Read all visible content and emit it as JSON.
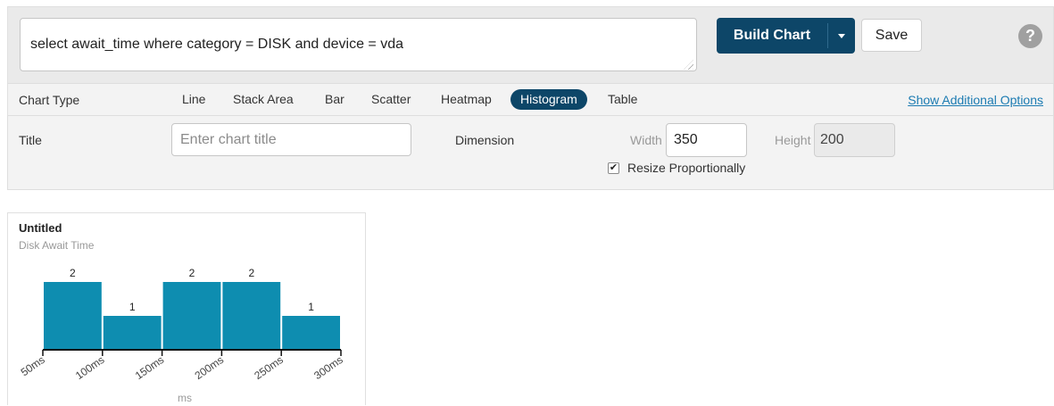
{
  "query": {
    "text": "select await_time where category = DISK and device = vda"
  },
  "toolbar": {
    "build_label": "Build Chart",
    "save_label": "Save",
    "help_label": "?"
  },
  "chart_types": {
    "label": "Chart Type",
    "items": [
      "Line",
      "Stack Area",
      "Bar",
      "Scatter",
      "Heatmap",
      "Histogram",
      "Table"
    ],
    "selected": "Histogram",
    "more_link": "Show Additional Options"
  },
  "options": {
    "title_label": "Title",
    "title_placeholder": "Enter chart title",
    "dimension_label": "Dimension",
    "width_label": "Width",
    "width_value": "350",
    "height_label": "Height",
    "height_value": "200",
    "resize_label": "Resize Proportionally",
    "resize_checked": true
  },
  "chart_card": {
    "title": "Untitled",
    "subtitle": "Disk Await Time"
  },
  "chart_data": {
    "type": "bar",
    "title": "Untitled",
    "subtitle": "Disk Await Time",
    "xlabel": "ms",
    "ylabel": "",
    "bins": [
      [
        50,
        100
      ],
      [
        100,
        150
      ],
      [
        150,
        200
      ],
      [
        200,
        250
      ],
      [
        250,
        300
      ]
    ],
    "values": [
      2,
      1,
      2,
      2,
      1
    ],
    "tick_labels": [
      "50ms",
      "100ms",
      "150ms",
      "200ms",
      "250ms",
      "300ms"
    ],
    "ylim": [
      0,
      2
    ],
    "bar_color": "#0e8db0",
    "grid": false
  },
  "colors": {
    "accent": "#0d4668",
    "link": "#1c7bb2",
    "bar": "#0e8db0"
  }
}
